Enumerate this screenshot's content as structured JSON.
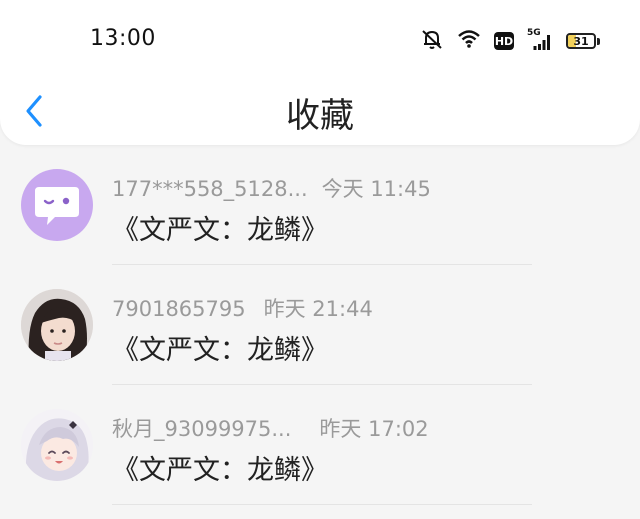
{
  "status_bar": {
    "time": "13:00",
    "hd": "HD",
    "network": "5G",
    "battery": "31",
    "battery_level": 0.31
  },
  "header": {
    "title": "收藏"
  },
  "items": [
    {
      "author": "177***558_5128...",
      "time": "今天 11:45",
      "title": "《文严文：龙鳞》",
      "avatar": "chat-bubble-avatar"
    },
    {
      "author": "7901865795",
      "time": "昨天 21:44",
      "title": "《文严文：龙鳞》",
      "avatar": "girl-photo-avatar"
    },
    {
      "author": "秋月_93099975...",
      "time": "昨天 17:02",
      "title": "《文严文：龙鳞》",
      "avatar": "anime-girl-avatar"
    }
  ],
  "colors": {
    "accent": "#1e90ff",
    "avatar_purple": "#c8a8ef",
    "battery_yellow": "#f2d15b"
  }
}
